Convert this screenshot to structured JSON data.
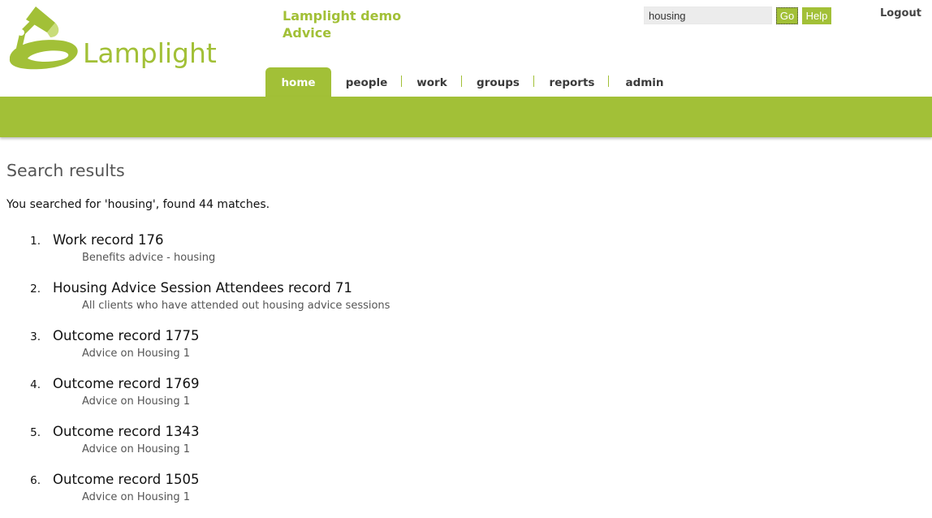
{
  "branding": {
    "logo_text": "Lamplight",
    "brand_color": "#a2c037",
    "org_line1": "Lamplight demo",
    "org_line2": "Advice"
  },
  "search": {
    "value": "housing",
    "go_label": "Go",
    "help_label": "Help"
  },
  "account": {
    "logout_label": "Logout"
  },
  "nav": {
    "tabs": [
      {
        "label": "home",
        "active": true
      },
      {
        "label": "people",
        "active": false
      },
      {
        "label": "work",
        "active": false
      },
      {
        "label": "groups",
        "active": false
      },
      {
        "label": "reports",
        "active": false
      },
      {
        "label": "admin",
        "active": false
      }
    ]
  },
  "main": {
    "heading": "Search results",
    "summary": "You searched for 'housing', found 44 matches.",
    "results": [
      {
        "num": "1.",
        "title": "Work record 176",
        "desc": "Benefits advice - housing"
      },
      {
        "num": "2.",
        "title": "Housing Advice Session Attendees record 71",
        "desc": "All clients who have attended out housing advice sessions"
      },
      {
        "num": "3.",
        "title": "Outcome record 1775",
        "desc": "Advice on Housing 1"
      },
      {
        "num": "4.",
        "title": "Outcome record 1769",
        "desc": "Advice on Housing 1"
      },
      {
        "num": "5.",
        "title": "Outcome record 1343",
        "desc": "Advice on Housing 1"
      },
      {
        "num": "6.",
        "title": "Outcome record 1505",
        "desc": "Advice on Housing 1"
      }
    ]
  }
}
